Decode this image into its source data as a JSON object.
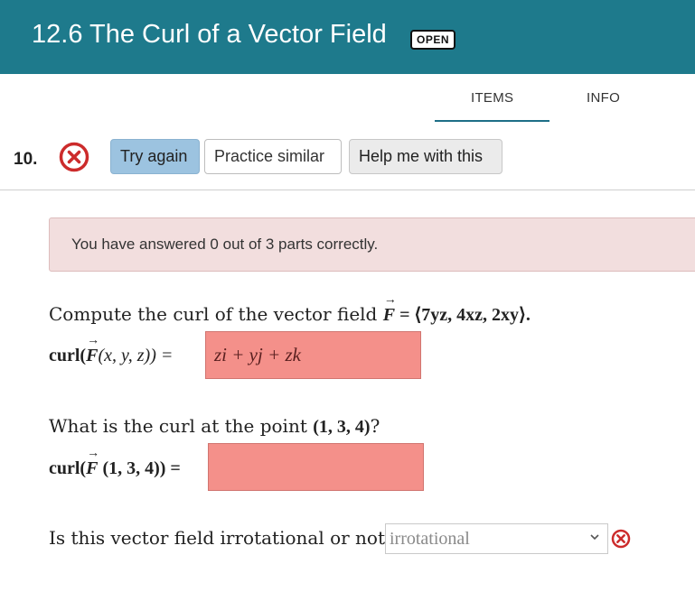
{
  "header": {
    "title": "12.6 The Curl of a Vector Field",
    "badge": "OPEN",
    "bg_color": "#1e7a8c"
  },
  "tabs": [
    {
      "label": "ITEMS",
      "active": true
    },
    {
      "label": "INFO",
      "active": false
    }
  ],
  "question": {
    "number": "10.",
    "status_icon": "x-circle-icon",
    "buttons": {
      "try_again": "Try again",
      "practice_similar": "Practice similar",
      "help": "Help me with this"
    }
  },
  "alert": {
    "text": "You have answered 0 out of 3 parts correctly."
  },
  "part1": {
    "prompt_prefix": "Compute the curl of the vector field ",
    "field": "F",
    "field_def": " = ⟨7yz, 4xz, 2xy⟩.",
    "label_prefix": "curl(",
    "label_args": "(x, y, z)) =",
    "answer": "zi + yj + zk"
  },
  "part2": {
    "prompt_prefix": "What is the curl at the point ",
    "point": "(1, 3, 4)",
    "prompt_suffix": "?",
    "label_prefix": "curl(",
    "label_args": " (1, 3, 4)) =",
    "answer": ""
  },
  "part3": {
    "prompt": "Is this vector field irrotational or not?",
    "selected": "irrotational",
    "status_icon": "x-circle-icon"
  },
  "colors": {
    "incorrect": "#cc2b2b",
    "answer_bg": "#f4908a",
    "alert_bg": "#f2dede",
    "try_again_bg": "#9cc3e0"
  }
}
